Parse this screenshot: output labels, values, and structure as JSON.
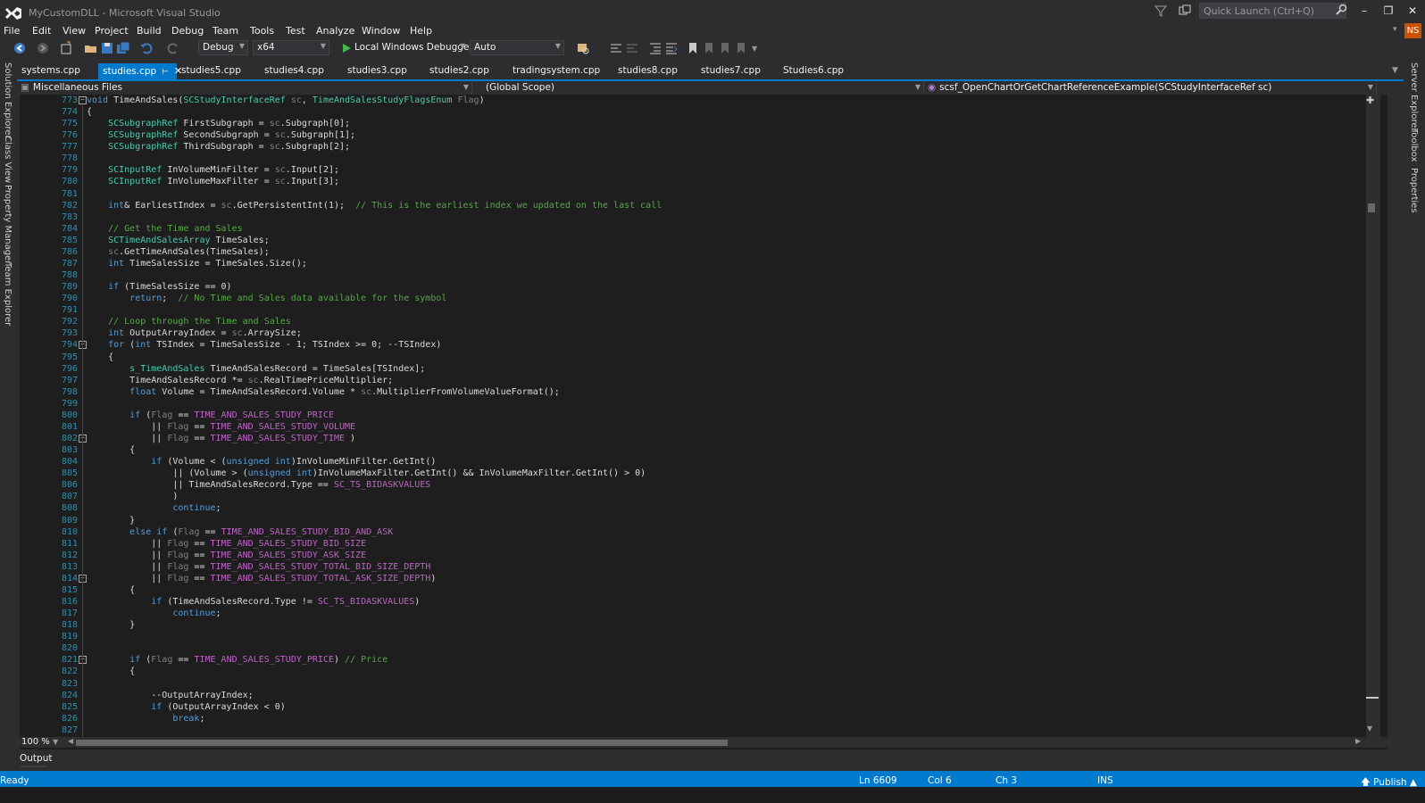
{
  "window": {
    "title": "MyCustomDLL - Microsoft Visual Studio",
    "quick_launch_placeholder": "Quick Launch (Ctrl+Q)",
    "account_initials": "NS"
  },
  "menu": [
    "File",
    "Edit",
    "View",
    "Project",
    "Build",
    "Debug",
    "Team",
    "Tools",
    "Test",
    "Analyze",
    "Window",
    "Help"
  ],
  "toolbar": {
    "configuration": "Debug",
    "platform": "x64",
    "debugger": "Local Windows Debugger",
    "debugger_mode": "Auto"
  },
  "tabs": [
    {
      "label": "systems.cpp",
      "active": false
    },
    {
      "label": "studies.cpp",
      "active": true
    },
    {
      "label": "studies5.cpp",
      "active": false
    },
    {
      "label": "studies4.cpp",
      "active": false
    },
    {
      "label": "studies3.cpp",
      "active": false
    },
    {
      "label": "studies2.cpp",
      "active": false
    },
    {
      "label": "tradingsystem.cpp",
      "active": false
    },
    {
      "label": "studies8.cpp",
      "active": false
    },
    {
      "label": "studies7.cpp",
      "active": false
    },
    {
      "label": "Studies6.cpp",
      "active": false
    }
  ],
  "navbar": {
    "project": "Miscellaneous Files",
    "scope": "(Global Scope)",
    "member": "scsf_OpenChartOrGetChartReferenceExample(SCStudyInterfaceRef sc)"
  },
  "left_rail": [
    "Solution Explorer",
    "Class View",
    "Property Manager",
    "Team Explorer"
  ],
  "right_rail": [
    "Server Explorer",
    "Toolbox",
    "Properties"
  ],
  "code_lines": [
    {
      "n": "773",
      "text": "void TimeAndSales(SCStudyInterfaceRef sc, TimeAndSalesStudyFlagsEnum Flag)"
    },
    {
      "n": "774",
      "text": "{"
    },
    {
      "n": "775",
      "text": "    SCSubgraphRef FirstSubgraph = sc.Subgraph[0];"
    },
    {
      "n": "776",
      "text": "    SCSubgraphRef SecondSubgraph = sc.Subgraph[1];"
    },
    {
      "n": "777",
      "text": "    SCSubgraphRef ThirdSubgraph = sc.Subgraph[2];"
    },
    {
      "n": "778",
      "text": ""
    },
    {
      "n": "779",
      "text": "    SCInputRef InVolumeMinFilter = sc.Input[2];"
    },
    {
      "n": "780",
      "text": "    SCInputRef InVolumeMaxFilter = sc.Input[3];"
    },
    {
      "n": "781",
      "text": ""
    },
    {
      "n": "782",
      "text": "    int& EarliestIndex = sc.GetPersistentInt(1);  // This is the earliest index we updated on the last call"
    },
    {
      "n": "783",
      "text": ""
    },
    {
      "n": "784",
      "text": "    // Get the Time and Sales"
    },
    {
      "n": "785",
      "text": "    SCTimeAndSalesArray TimeSales;"
    },
    {
      "n": "786",
      "text": "    sc.GetTimeAndSales(TimeSales);"
    },
    {
      "n": "787",
      "text": "    int TimeSalesSize = TimeSales.Size();"
    },
    {
      "n": "788",
      "text": ""
    },
    {
      "n": "789",
      "text": "    if (TimeSalesSize == 0)"
    },
    {
      "n": "790",
      "text": "        return;  // No Time and Sales data available for the symbol"
    },
    {
      "n": "791",
      "text": ""
    },
    {
      "n": "792",
      "text": "    // Loop through the Time and Sales"
    },
    {
      "n": "793",
      "text": "    int OutputArrayIndex = sc.ArraySize;"
    },
    {
      "n": "794",
      "text": "    for (int TSIndex = TimeSalesSize - 1; TSIndex >= 0; --TSIndex)"
    },
    {
      "n": "795",
      "text": "    {"
    },
    {
      "n": "796",
      "text": "        s_TimeAndSales TimeAndSalesRecord = TimeSales[TSIndex];"
    },
    {
      "n": "797",
      "text": "        TimeAndSalesRecord *= sc.RealTimePriceMultiplier;"
    },
    {
      "n": "798",
      "text": "        float Volume = TimeAndSalesRecord.Volume * sc.MultiplierFromVolumeValueFormat();"
    },
    {
      "n": "799",
      "text": ""
    },
    {
      "n": "800",
      "text": "        if (Flag == TIME_AND_SALES_STUDY_PRICE"
    },
    {
      "n": "801",
      "text": "            || Flag == TIME_AND_SALES_STUDY_VOLUME"
    },
    {
      "n": "802",
      "text": "            || Flag == TIME_AND_SALES_STUDY_TIME )"
    },
    {
      "n": "803",
      "text": "        {"
    },
    {
      "n": "804",
      "text": "            if (Volume < (unsigned int)InVolumeMinFilter.GetInt()"
    },
    {
      "n": "805",
      "text": "                || (Volume > (unsigned int)InVolumeMaxFilter.GetInt() && InVolumeMaxFilter.GetInt() > 0)"
    },
    {
      "n": "806",
      "text": "                || TimeAndSalesRecord.Type == SC_TS_BIDASKVALUES"
    },
    {
      "n": "807",
      "text": "                )"
    },
    {
      "n": "808",
      "text": "                continue;"
    },
    {
      "n": "809",
      "text": "        }"
    },
    {
      "n": "810",
      "text": "        else if (Flag == TIME_AND_SALES_STUDY_BID_AND_ASK"
    },
    {
      "n": "811",
      "text": "            || Flag == TIME_AND_SALES_STUDY_BID_SIZE"
    },
    {
      "n": "812",
      "text": "            || Flag == TIME_AND_SALES_STUDY_ASK_SIZE"
    },
    {
      "n": "813",
      "text": "            || Flag == TIME_AND_SALES_STUDY_TOTAL_BID_SIZE_DEPTH"
    },
    {
      "n": "814",
      "text": "            || Flag == TIME_AND_SALES_STUDY_TOTAL_ASK_SIZE_DEPTH)"
    },
    {
      "n": "815",
      "text": "        {"
    },
    {
      "n": "816",
      "text": "            if (TimeAndSalesRecord.Type != SC_TS_BIDASKVALUES)"
    },
    {
      "n": "817",
      "text": "                continue;"
    },
    {
      "n": "818",
      "text": "        }"
    },
    {
      "n": "819",
      "text": ""
    },
    {
      "n": "820",
      "text": ""
    },
    {
      "n": "821",
      "text": "        if (Flag == TIME_AND_SALES_STUDY_PRICE) // Price"
    },
    {
      "n": "822",
      "text": "        {"
    },
    {
      "n": "823",
      "text": ""
    },
    {
      "n": "824",
      "text": "            --OutputArrayIndex;"
    },
    {
      "n": "825",
      "text": "            if (OutputArrayIndex < 0)"
    },
    {
      "n": "826",
      "text": "                break;"
    },
    {
      "n": "827",
      "text": ""
    }
  ],
  "editor": {
    "zoom": "100 %",
    "output_tab": "Output"
  },
  "status": {
    "state": "Ready",
    "line": "Ln 6609",
    "col": "Col 6",
    "ch": "Ch 3",
    "mode": "INS",
    "publish": "Publish"
  },
  "colors": {
    "accent": "#007acc",
    "keyword": "#569cd6",
    "type": "#4ec9b0",
    "comment": "#57a64a",
    "line_number": "#2b91af"
  }
}
